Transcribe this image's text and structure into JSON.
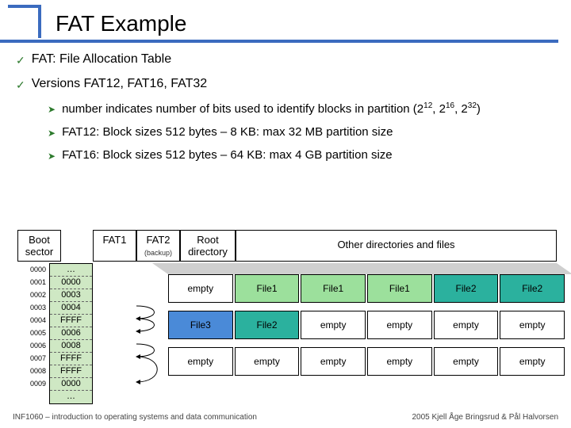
{
  "title": "FAT Example",
  "bullets": {
    "b1": "FAT: File Allocation Table",
    "b2": "Versions FAT12, FAT16, FAT32",
    "sub1_pre": "number indicates number of bits used to identify blocks in partition (2",
    "sub1_e1": "12",
    "sub1_m1": ", 2",
    "sub1_e2": "16",
    "sub1_m2": ", 2",
    "sub1_e3": "32",
    "sub1_post": ")",
    "sub2": "FAT12: Block sizes 512 bytes – 8 KB: max 32 MB partition size",
    "sub3": "FAT16: Block sizes 512 bytes – 64 KB: max 4 GB partition size"
  },
  "headers": {
    "boot": "Boot sector",
    "fat1": "FAT1",
    "fat2": "FAT2",
    "fat2_sub": "(backup)",
    "root": "Root directory",
    "other": "Other directories and files"
  },
  "fat_addresses": [
    "0000",
    "0001",
    "0002",
    "0003",
    "0004",
    "0005",
    "0006",
    "0007",
    "0008",
    "0009"
  ],
  "fat_values": [
    "…",
    "0000",
    "0003",
    "0004",
    "FFFF",
    "0006",
    "0008",
    "FFFF",
    "FFFF",
    "0000",
    "…"
  ],
  "block_rows": [
    [
      {
        "label": "empty",
        "cls": ""
      },
      {
        "label": "File1",
        "cls": "c-green"
      },
      {
        "label": "File1",
        "cls": "c-green"
      },
      {
        "label": "File1",
        "cls": "c-green"
      },
      {
        "label": "File2",
        "cls": "c-teal"
      },
      {
        "label": "File2",
        "cls": "c-teal"
      }
    ],
    [
      {
        "label": "File3",
        "cls": "c-blue"
      },
      {
        "label": "File2",
        "cls": "c-teal"
      },
      {
        "label": "empty",
        "cls": ""
      },
      {
        "label": "empty",
        "cls": ""
      },
      {
        "label": "empty",
        "cls": ""
      },
      {
        "label": "empty",
        "cls": ""
      }
    ],
    [
      {
        "label": "empty",
        "cls": ""
      },
      {
        "label": "empty",
        "cls": ""
      },
      {
        "label": "empty",
        "cls": ""
      },
      {
        "label": "empty",
        "cls": ""
      },
      {
        "label": "empty",
        "cls": ""
      },
      {
        "label": "empty",
        "cls": ""
      }
    ]
  ],
  "footer": {
    "left": "INF1060 – introduction to operating systems and data communication",
    "right": "2005 Kjell Åge Bringsrud & Pål Halvorsen"
  }
}
